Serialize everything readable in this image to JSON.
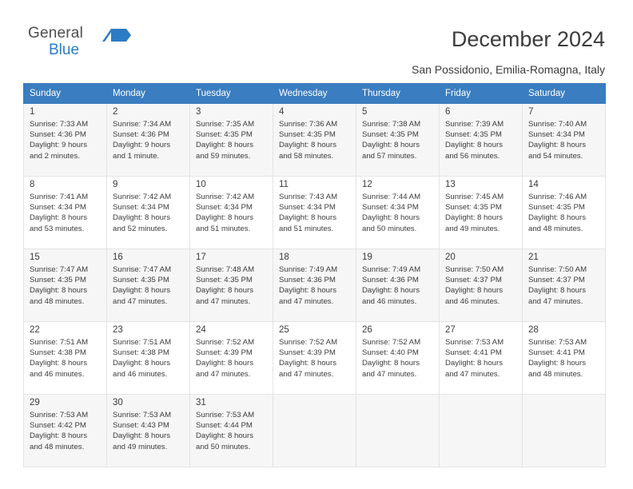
{
  "logo": {
    "line1": "General",
    "line2": "Blue",
    "flag_icon": "flag-icon",
    "colors": {
      "blue": "#2b7cc4",
      "gray": "#4d4d4d"
    }
  },
  "header": {
    "title": "December 2024",
    "subtitle": "San Possidonio, Emilia-Romagna, Italy"
  },
  "calendar": {
    "weekday_headers": [
      "Sunday",
      "Monday",
      "Tuesday",
      "Wednesday",
      "Thursday",
      "Friday",
      "Saturday"
    ],
    "header_color": "#3a7dc0",
    "weeks": [
      [
        {
          "day": "1",
          "sunrise": "Sunrise: 7:33 AM",
          "sunset": "Sunset: 4:36 PM",
          "daylight1": "Daylight: 9 hours",
          "daylight2": "and 2 minutes."
        },
        {
          "day": "2",
          "sunrise": "Sunrise: 7:34 AM",
          "sunset": "Sunset: 4:36 PM",
          "daylight1": "Daylight: 9 hours",
          "daylight2": "and 1 minute."
        },
        {
          "day": "3",
          "sunrise": "Sunrise: 7:35 AM",
          "sunset": "Sunset: 4:35 PM",
          "daylight1": "Daylight: 8 hours",
          "daylight2": "and 59 minutes."
        },
        {
          "day": "4",
          "sunrise": "Sunrise: 7:36 AM",
          "sunset": "Sunset: 4:35 PM",
          "daylight1": "Daylight: 8 hours",
          "daylight2": "and 58 minutes."
        },
        {
          "day": "5",
          "sunrise": "Sunrise: 7:38 AM",
          "sunset": "Sunset: 4:35 PM",
          "daylight1": "Daylight: 8 hours",
          "daylight2": "and 57 minutes."
        },
        {
          "day": "6",
          "sunrise": "Sunrise: 7:39 AM",
          "sunset": "Sunset: 4:35 PM",
          "daylight1": "Daylight: 8 hours",
          "daylight2": "and 56 minutes."
        },
        {
          "day": "7",
          "sunrise": "Sunrise: 7:40 AM",
          "sunset": "Sunset: 4:34 PM",
          "daylight1": "Daylight: 8 hours",
          "daylight2": "and 54 minutes."
        }
      ],
      [
        {
          "day": "8",
          "sunrise": "Sunrise: 7:41 AM",
          "sunset": "Sunset: 4:34 PM",
          "daylight1": "Daylight: 8 hours",
          "daylight2": "and 53 minutes."
        },
        {
          "day": "9",
          "sunrise": "Sunrise: 7:42 AM",
          "sunset": "Sunset: 4:34 PM",
          "daylight1": "Daylight: 8 hours",
          "daylight2": "and 52 minutes."
        },
        {
          "day": "10",
          "sunrise": "Sunrise: 7:42 AM",
          "sunset": "Sunset: 4:34 PM",
          "daylight1": "Daylight: 8 hours",
          "daylight2": "and 51 minutes."
        },
        {
          "day": "11",
          "sunrise": "Sunrise: 7:43 AM",
          "sunset": "Sunset: 4:34 PM",
          "daylight1": "Daylight: 8 hours",
          "daylight2": "and 51 minutes."
        },
        {
          "day": "12",
          "sunrise": "Sunrise: 7:44 AM",
          "sunset": "Sunset: 4:34 PM",
          "daylight1": "Daylight: 8 hours",
          "daylight2": "and 50 minutes."
        },
        {
          "day": "13",
          "sunrise": "Sunrise: 7:45 AM",
          "sunset": "Sunset: 4:35 PM",
          "daylight1": "Daylight: 8 hours",
          "daylight2": "and 49 minutes."
        },
        {
          "day": "14",
          "sunrise": "Sunrise: 7:46 AM",
          "sunset": "Sunset: 4:35 PM",
          "daylight1": "Daylight: 8 hours",
          "daylight2": "and 48 minutes."
        }
      ],
      [
        {
          "day": "15",
          "sunrise": "Sunrise: 7:47 AM",
          "sunset": "Sunset: 4:35 PM",
          "daylight1": "Daylight: 8 hours",
          "daylight2": "and 48 minutes."
        },
        {
          "day": "16",
          "sunrise": "Sunrise: 7:47 AM",
          "sunset": "Sunset: 4:35 PM",
          "daylight1": "Daylight: 8 hours",
          "daylight2": "and 47 minutes."
        },
        {
          "day": "17",
          "sunrise": "Sunrise: 7:48 AM",
          "sunset": "Sunset: 4:35 PM",
          "daylight1": "Daylight: 8 hours",
          "daylight2": "and 47 minutes."
        },
        {
          "day": "18",
          "sunrise": "Sunrise: 7:49 AM",
          "sunset": "Sunset: 4:36 PM",
          "daylight1": "Daylight: 8 hours",
          "daylight2": "and 47 minutes."
        },
        {
          "day": "19",
          "sunrise": "Sunrise: 7:49 AM",
          "sunset": "Sunset: 4:36 PM",
          "daylight1": "Daylight: 8 hours",
          "daylight2": "and 46 minutes."
        },
        {
          "day": "20",
          "sunrise": "Sunrise: 7:50 AM",
          "sunset": "Sunset: 4:37 PM",
          "daylight1": "Daylight: 8 hours",
          "daylight2": "and 46 minutes."
        },
        {
          "day": "21",
          "sunrise": "Sunrise: 7:50 AM",
          "sunset": "Sunset: 4:37 PM",
          "daylight1": "Daylight: 8 hours",
          "daylight2": "and 47 minutes."
        }
      ],
      [
        {
          "day": "22",
          "sunrise": "Sunrise: 7:51 AM",
          "sunset": "Sunset: 4:38 PM",
          "daylight1": "Daylight: 8 hours",
          "daylight2": "and 46 minutes."
        },
        {
          "day": "23",
          "sunrise": "Sunrise: 7:51 AM",
          "sunset": "Sunset: 4:38 PM",
          "daylight1": "Daylight: 8 hours",
          "daylight2": "and 46 minutes."
        },
        {
          "day": "24",
          "sunrise": "Sunrise: 7:52 AM",
          "sunset": "Sunset: 4:39 PM",
          "daylight1": "Daylight: 8 hours",
          "daylight2": "and 47 minutes."
        },
        {
          "day": "25",
          "sunrise": "Sunrise: 7:52 AM",
          "sunset": "Sunset: 4:39 PM",
          "daylight1": "Daylight: 8 hours",
          "daylight2": "and 47 minutes."
        },
        {
          "day": "26",
          "sunrise": "Sunrise: 7:52 AM",
          "sunset": "Sunset: 4:40 PM",
          "daylight1": "Daylight: 8 hours",
          "daylight2": "and 47 minutes."
        },
        {
          "day": "27",
          "sunrise": "Sunrise: 7:53 AM",
          "sunset": "Sunset: 4:41 PM",
          "daylight1": "Daylight: 8 hours",
          "daylight2": "and 47 minutes."
        },
        {
          "day": "28",
          "sunrise": "Sunrise: 7:53 AM",
          "sunset": "Sunset: 4:41 PM",
          "daylight1": "Daylight: 8 hours",
          "daylight2": "and 48 minutes."
        }
      ],
      [
        {
          "day": "29",
          "sunrise": "Sunrise: 7:53 AM",
          "sunset": "Sunset: 4:42 PM",
          "daylight1": "Daylight: 8 hours",
          "daylight2": "and 48 minutes."
        },
        {
          "day": "30",
          "sunrise": "Sunrise: 7:53 AM",
          "sunset": "Sunset: 4:43 PM",
          "daylight1": "Daylight: 8 hours",
          "daylight2": "and 49 minutes."
        },
        {
          "day": "31",
          "sunrise": "Sunrise: 7:53 AM",
          "sunset": "Sunset: 4:44 PM",
          "daylight1": "Daylight: 8 hours",
          "daylight2": "and 50 minutes."
        },
        {
          "day": "",
          "sunrise": "",
          "sunset": "",
          "daylight1": "",
          "daylight2": ""
        },
        {
          "day": "",
          "sunrise": "",
          "sunset": "",
          "daylight1": "",
          "daylight2": ""
        },
        {
          "day": "",
          "sunrise": "",
          "sunset": "",
          "daylight1": "",
          "daylight2": ""
        },
        {
          "day": "",
          "sunrise": "",
          "sunset": "",
          "daylight1": "",
          "daylight2": ""
        }
      ]
    ]
  }
}
